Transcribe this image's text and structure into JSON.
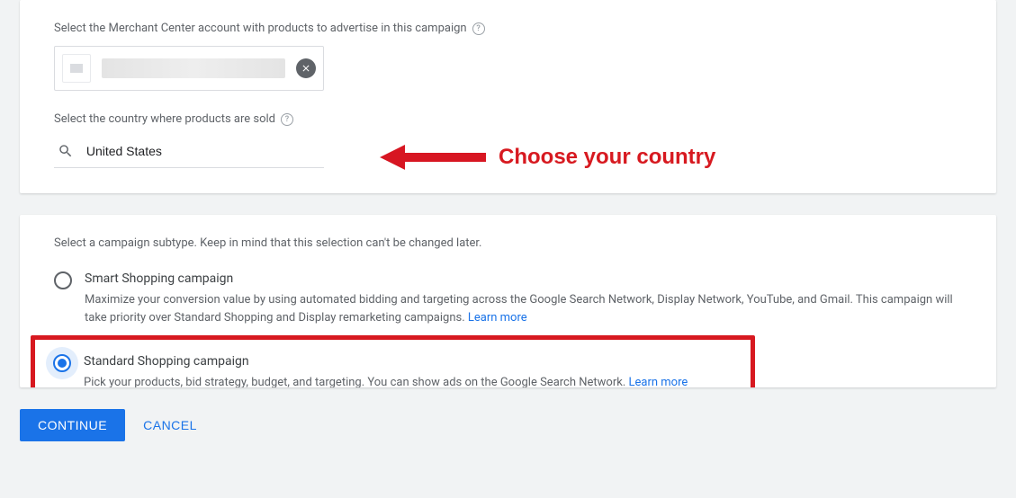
{
  "card1": {
    "merchant_label": "Select the Merchant Center account with products to advertise in this campaign",
    "country_label": "Select the country where products are sold",
    "country_value": "United States"
  },
  "annotation": {
    "text": "Choose your country"
  },
  "card2": {
    "subtype_label": "Select a campaign subtype. Keep in mind that this selection can't be changed later.",
    "options": [
      {
        "title": "Smart Shopping campaign",
        "desc": "Maximize your conversion value by using automated bidding and targeting across the Google Search Network, Display Network, YouTube, and Gmail. This campaign will take priority over Standard Shopping and Display remarketing campaigns.",
        "learn_more": "Learn more"
      },
      {
        "title": "Standard Shopping campaign",
        "desc": "Pick your products, bid strategy, budget, and targeting. You can show ads on the Google Search Network.",
        "learn_more": "Learn more"
      }
    ]
  },
  "footer": {
    "continue_label": "CONTINUE",
    "cancel_label": "CANCEL"
  }
}
